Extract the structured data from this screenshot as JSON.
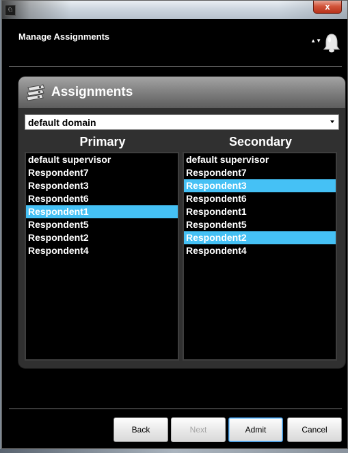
{
  "window": {
    "app_icon_glyph": "♘",
    "close_label": "x"
  },
  "header": {
    "title": "Manage Assignments",
    "sort_glyph": "▲▼"
  },
  "panel": {
    "title": "Assignments",
    "domain": "default domain",
    "primary_label": "Primary",
    "secondary_label": "Secondary",
    "primary_items": [
      {
        "label": "default supervisor",
        "selected": false
      },
      {
        "label": "Respondent7",
        "selected": false
      },
      {
        "label": "Respondent3",
        "selected": false
      },
      {
        "label": "Respondent6",
        "selected": false
      },
      {
        "label": "Respondent1",
        "selected": true
      },
      {
        "label": "Respondent5",
        "selected": false
      },
      {
        "label": "Respondent2",
        "selected": false
      },
      {
        "label": "Respondent4",
        "selected": false
      }
    ],
    "secondary_items": [
      {
        "label": "default supervisor",
        "selected": false
      },
      {
        "label": "Respondent7",
        "selected": false
      },
      {
        "label": "Respondent3",
        "selected": true
      },
      {
        "label": "Respondent6",
        "selected": false
      },
      {
        "label": "Respondent1",
        "selected": false
      },
      {
        "label": "Respondent5",
        "selected": false
      },
      {
        "label": "Respondent2",
        "selected": true
      },
      {
        "label": "Respondent4",
        "selected": false
      }
    ]
  },
  "footer": {
    "back": "Back",
    "next": "Next",
    "admit": "Admit",
    "cancel": "Cancel"
  },
  "colors": {
    "selection": "#45c1f5",
    "panel_background": "#303030"
  },
  "icons": {
    "notifications": "bell-icon",
    "panel": "assignments-icon",
    "sort": "sort-arrows-icon"
  }
}
